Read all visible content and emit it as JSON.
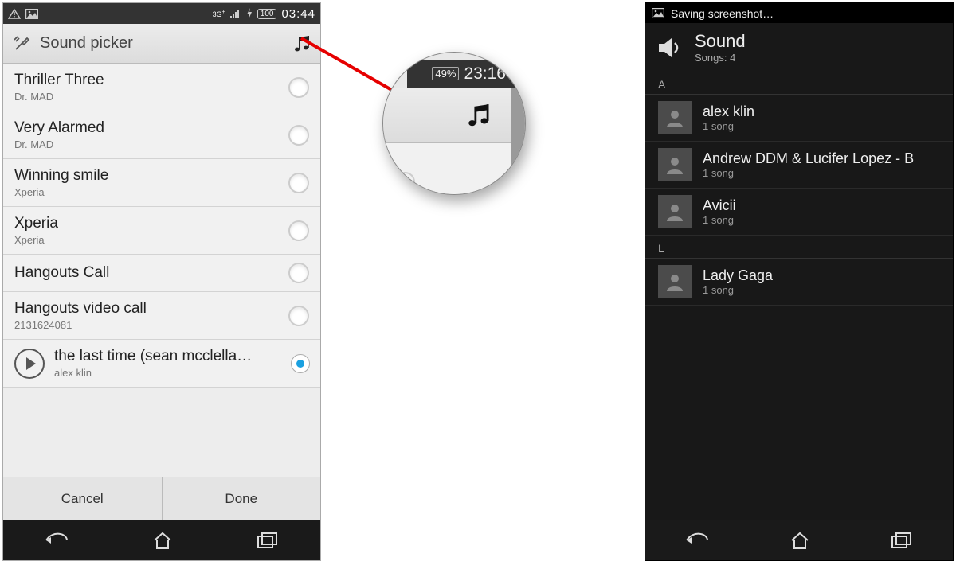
{
  "left": {
    "statusbar": {
      "net_label": "3G",
      "battery": "100",
      "time": "03:44"
    },
    "appbar": {
      "title": "Sound picker"
    },
    "items": [
      {
        "title": "Thriller Three",
        "sub": "Dr. MAD",
        "selected": false
      },
      {
        "title": "Very Alarmed",
        "sub": "Dr. MAD",
        "selected": false
      },
      {
        "title": "Winning smile",
        "sub": "Xperia",
        "selected": false
      },
      {
        "title": "Xperia",
        "sub": "Xperia",
        "selected": false
      },
      {
        "title": "Hangouts Call",
        "sub": "",
        "selected": false
      },
      {
        "title": "Hangouts video call",
        "sub": "2131624081",
        "selected": false
      },
      {
        "title": "the last time (sean mcclella…",
        "sub": "alex klin",
        "selected": true,
        "play": true
      }
    ],
    "buttons": {
      "cancel": "Cancel",
      "done": "Done"
    }
  },
  "magnifier": {
    "battery": "49%",
    "time": "23:16"
  },
  "right": {
    "statusbar": {
      "text": "Saving screenshot…"
    },
    "header": {
      "title": "Sound",
      "sub": "Songs: 4"
    },
    "sections": [
      {
        "letter": "A",
        "rows": [
          {
            "name": "alex klin",
            "sub": "1 song"
          },
          {
            "name": "Andrew DDM & Lucifer Lopez - B",
            "sub": "1 song"
          },
          {
            "name": "Avicii",
            "sub": "1 song"
          }
        ]
      },
      {
        "letter": "L",
        "rows": [
          {
            "name": "Lady Gaga",
            "sub": "1 song"
          }
        ]
      }
    ]
  }
}
